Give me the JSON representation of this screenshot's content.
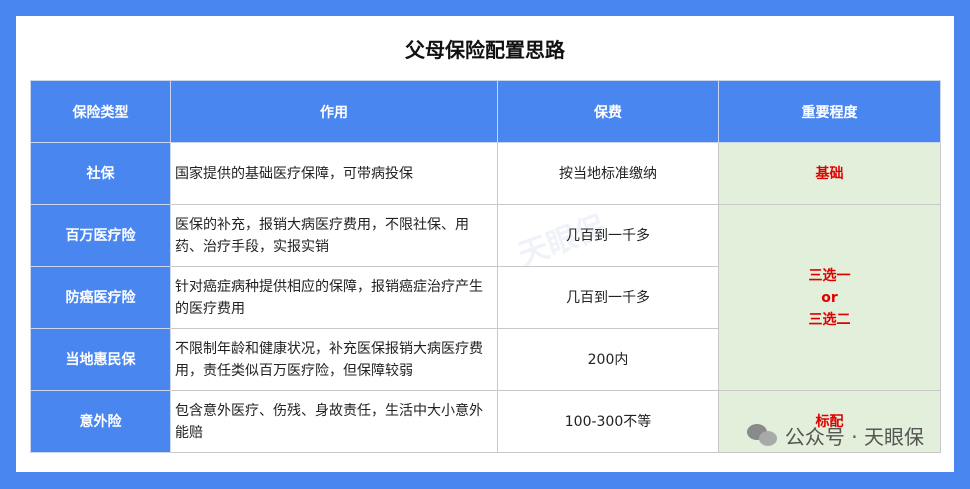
{
  "title": "父母保险配置思路",
  "headers": {
    "type": "保险类型",
    "effect": "作用",
    "premium": "保费",
    "importance": "重要程度"
  },
  "rows": [
    {
      "type": "社保",
      "effect": "国家提供的基础医疗保障，可带病投保",
      "premium": "按当地标准缴纳"
    },
    {
      "type": "百万医疗险",
      "effect": "医保的补充，报销大病医疗费用，不限社保、用药、治疗手段，实报实销",
      "premium": "几百到一千多"
    },
    {
      "type": "防癌医疗险",
      "effect": "针对癌症病种提供相应的保障，报销癌症治疗产生的医疗费用",
      "premium": "几百到一千多"
    },
    {
      "type": "当地惠民保",
      "effect": "不限制年龄和健康状况，补充医保报销大病医疗费用，责任类似百万医疗险，但保障较弱",
      "premium": "200内"
    },
    {
      "type": "意外险",
      "effect": "包含意外医疗、伤残、身故责任，生活中大小意外能赔",
      "premium": "100-300不等"
    }
  ],
  "importance": {
    "basic": "基础",
    "choice_line1": "三选一",
    "choice_line2": "or",
    "choice_line3": "三选二",
    "standard": "标配"
  },
  "watermark": "天眼保",
  "footer": "公众号 · 天眼保",
  "colors": {
    "header_bg": "#4a86f0",
    "importance_bg": "#e2efda",
    "importance_text": "#e00000"
  }
}
